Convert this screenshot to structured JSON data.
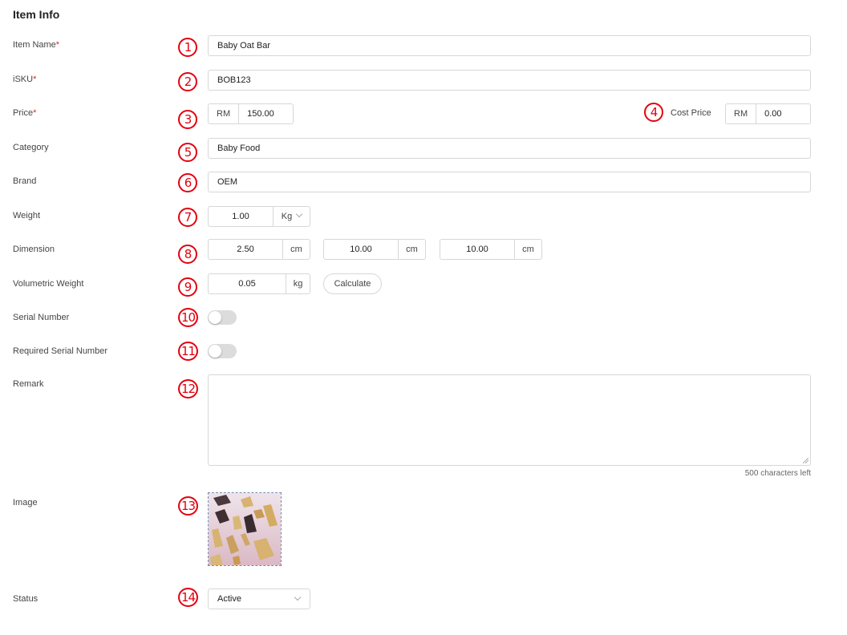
{
  "section_title": "Item Info",
  "required_mark": "*",
  "badges": [
    "1",
    "2",
    "3",
    "4",
    "5",
    "6",
    "7",
    "8",
    "9",
    "10",
    "11",
    "12",
    "13",
    "14"
  ],
  "item_name": {
    "label": "Item Name",
    "value": "Baby Oat Bar"
  },
  "isku": {
    "label": "iSKU",
    "value": "BOB123"
  },
  "price": {
    "label": "Price",
    "currency": "RM",
    "value": "150.00"
  },
  "cost_price": {
    "label": "Cost Price",
    "currency": "RM",
    "value": "0.00"
  },
  "category": {
    "label": "Category",
    "value": "Baby Food"
  },
  "brand": {
    "label": "Brand",
    "value": "OEM"
  },
  "weight": {
    "label": "Weight",
    "value": "1.00",
    "unit": "Kg"
  },
  "dimension": {
    "label": "Dimension",
    "values": [
      "2.50",
      "10.00",
      "10.00"
    ],
    "unit": "cm"
  },
  "volumetric_weight": {
    "label": "Volumetric Weight",
    "value": "0.05",
    "unit": "kg",
    "button": "Calculate"
  },
  "serial_number": {
    "label": "Serial Number",
    "enabled": false
  },
  "required_serial_number": {
    "label": "Required Serial Number",
    "enabled": false
  },
  "remark": {
    "label": "Remark",
    "value": "",
    "counter": "500 characters left"
  },
  "image": {
    "label": "Image"
  },
  "status": {
    "label": "Status",
    "value": "Active"
  },
  "colors": {
    "accent": "#e3000f",
    "required": "#e02424",
    "border": "#d7d7d7"
  }
}
